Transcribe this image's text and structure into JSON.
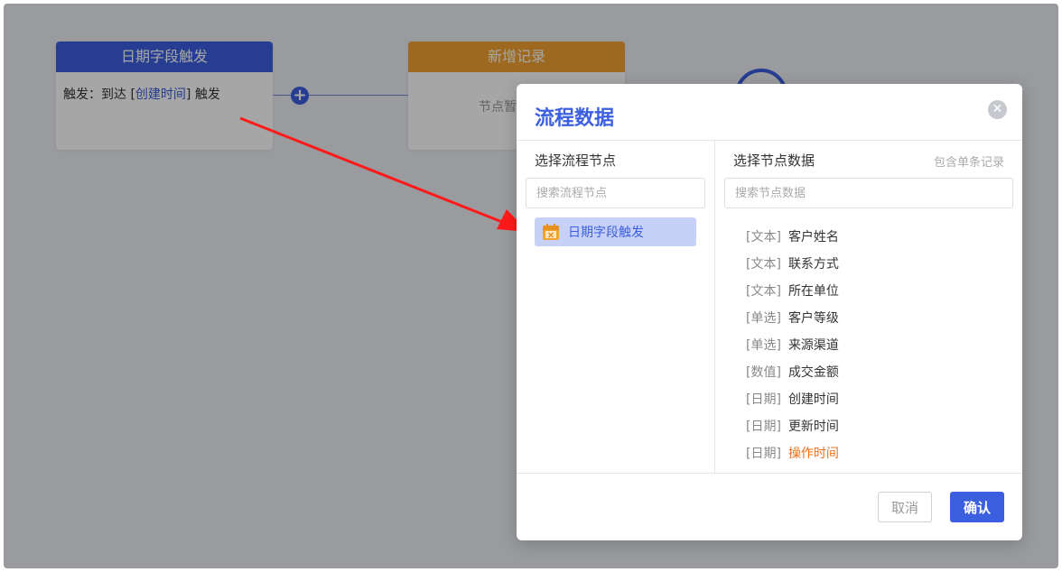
{
  "canvas": {
    "trigger_node": {
      "title": "日期字段触发",
      "prefix": "触发：到达 [",
      "field": "创建时间",
      "suffix": "] 触发"
    },
    "add_node": {
      "title": "新增记录",
      "body": "节点暂"
    },
    "plus_glyph": "+"
  },
  "dialog": {
    "title": "流程数据",
    "close_glyph": "✕",
    "left": {
      "title": "选择流程节点",
      "search_placeholder": "搜索流程节点",
      "items": [
        {
          "label": "日期字段触发",
          "icon": "calendar-icon"
        }
      ]
    },
    "right": {
      "title": "选择节点数据",
      "hint": "包含单条记录",
      "search_placeholder": "搜索节点数据",
      "fields": [
        {
          "type": "[文本]",
          "name": "客户姓名"
        },
        {
          "type": "[文本]",
          "name": "联系方式"
        },
        {
          "type": "[文本]",
          "name": "所在单位"
        },
        {
          "type": "[单选]",
          "name": "客户等级"
        },
        {
          "type": "[单选]",
          "name": "来源渠道"
        },
        {
          "type": "[数值]",
          "name": "成交金额"
        },
        {
          "type": "[日期]",
          "name": "创建时间"
        },
        {
          "type": "[日期]",
          "name": "更新时间"
        },
        {
          "type": "[日期]",
          "name": "操作时间"
        }
      ]
    },
    "cancel_label": "取消",
    "ok_label": "确认"
  },
  "colors": {
    "primary": "#3c5fe0",
    "orange_header": "#f2a233",
    "active_field": "#f07019",
    "arrow": "#ff1a1a"
  }
}
